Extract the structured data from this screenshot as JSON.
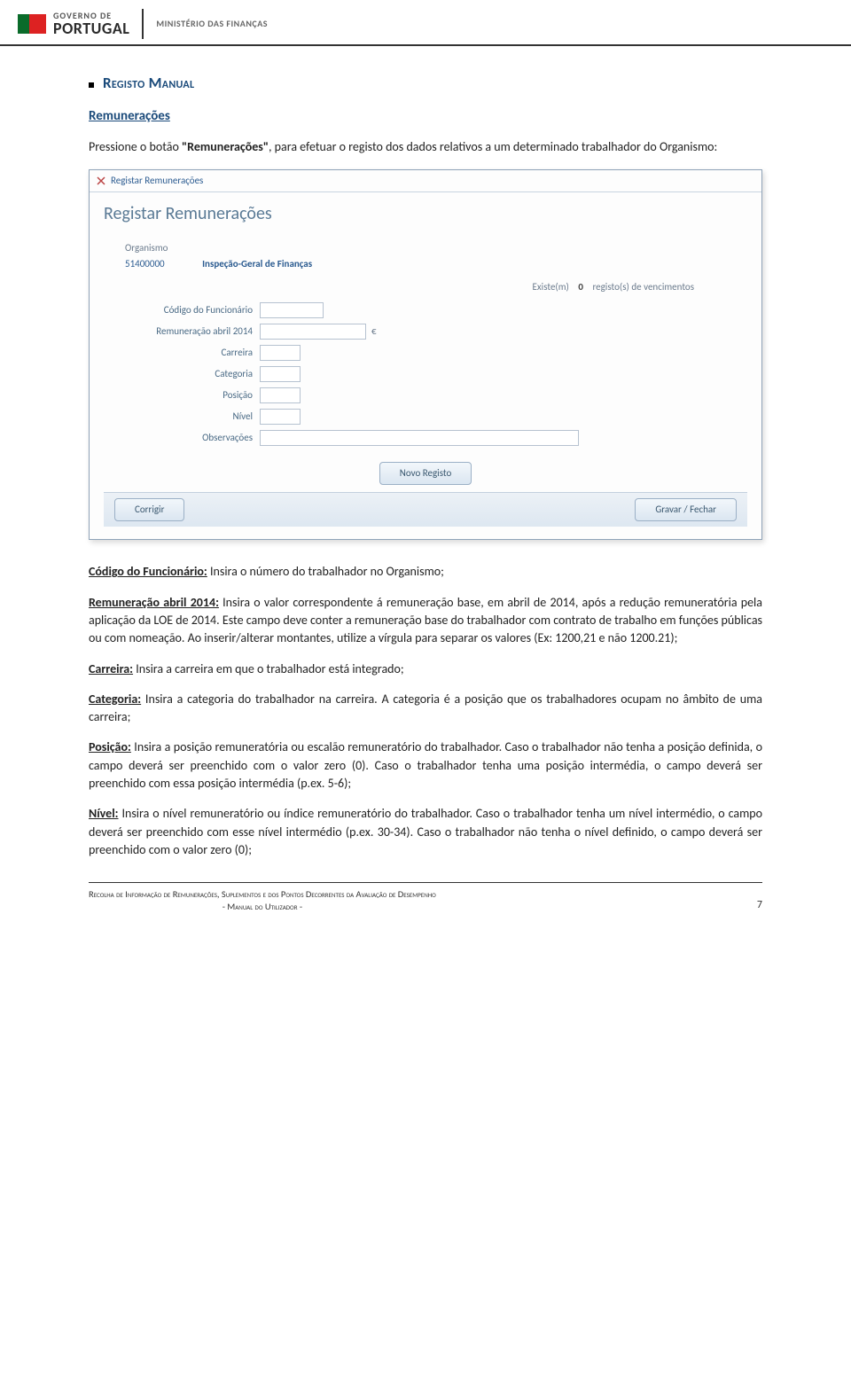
{
  "header": {
    "gov_small": "GOVERNO DE",
    "gov_big": "PORTUGAL",
    "ministry": "MINISTÉRIO DAS FINANÇAS"
  },
  "section": {
    "bullet_title": "Registo Manual",
    "sub_link": "Remunerações",
    "intro_before": "Pressione o botão ",
    "intro_quoted": "\"Remunerações\"",
    "intro_after": ", para efetuar o registo dos dados relativos a um determinado trabalhador do Organismo:"
  },
  "screenshot": {
    "tab_label": "Registar Remunerações",
    "panel_title": "Registar Remunerações",
    "org_label": "Organismo",
    "org_code": "51400000",
    "org_name": "Inspeção-Geral de Finanças",
    "count_pre": "Existe(m)",
    "count_val": "0",
    "count_post": "registo(s) de vencimentos",
    "fields": {
      "codigo": "Código do Funcionário",
      "remun": "Remuneração abril 2014",
      "remun_suffix": "€",
      "carreira": "Carreira",
      "categoria": "Categoria",
      "posicao": "Posição",
      "nivel": "Nível",
      "obs": "Observações"
    },
    "btn_novo": "Novo Registo",
    "btn_corrigir": "Corrigir",
    "btn_gravar": "Gravar / Fechar"
  },
  "definitions": {
    "codigo_title": "Código do Funcionário:",
    "codigo_text": " Insira o número do trabalhador no Organismo;",
    "remun_title": "Remuneração abril 2014:",
    "remun_text": " Insira o valor correspondente á remuneração base, em abril de 2014, após a redução remuneratória pela aplicação da LOE de 2014. Este campo deve conter a remuneração base do trabalhador com contrato de trabalho em funções públicas ou com nomeação. Ao inserir/alterar montantes, utilize a vírgula para separar os valores (Ex: 1200,21 e não 1200.21);",
    "carreira_title": "Carreira:",
    "carreira_text": " Insira a carreira em que o trabalhador está integrado;",
    "categoria_title": "Categoria:",
    "categoria_text": " Insira a categoria do trabalhador na carreira. A categoria é a posição que os trabalhadores ocupam no âmbito de uma carreira;",
    "posicao_title": "Posição:",
    "posicao_text": " Insira a posição remuneratória ou escalão remuneratório do trabalhador. Caso o trabalhador não tenha a posição definida, o campo deverá ser preenchido com o valor zero (0). Caso o trabalhador tenha uma posição intermédia, o campo deverá ser preenchido com essa posição intermédia (p.ex. 5-6);",
    "nivel_title": "Nível:",
    "nivel_text": " Insira o nível remuneratório ou índice remuneratório do trabalhador. Caso o trabalhador tenha um nível intermédio, o campo deverá ser preenchido com esse nível intermédio (p.ex. 30-34). Caso o trabalhador não tenha o nível definido, o campo deverá ser preenchido com o valor zero (0);"
  },
  "footer": {
    "line1": "Recolha de Informação de Remunerações, Suplementos e dos Pontos Decorrentes da Avaliação de Desempenho",
    "line2": "- Manual do Utilizador -",
    "page": "7"
  }
}
